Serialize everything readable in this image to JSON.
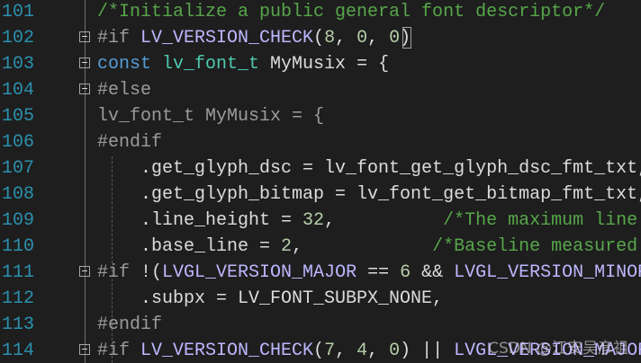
{
  "editor": {
    "lines": [
      {
        "num": "101",
        "tokens": [
          {
            "c": "cm",
            "t": "/*Initialize a public general font descriptor*/"
          }
        ]
      },
      {
        "num": "102",
        "tokens": [
          {
            "c": "pp",
            "t": "#if "
          },
          {
            "c": "mc",
            "t": "LV_VERSION_CHECK"
          },
          {
            "c": "id",
            "t": "("
          },
          {
            "c": "num",
            "t": "8"
          },
          {
            "c": "id",
            "t": ", "
          },
          {
            "c": "num",
            "t": "0"
          },
          {
            "c": "id",
            "t": ", "
          },
          {
            "c": "num",
            "t": "0"
          },
          {
            "c": "id",
            "t": ")"
          }
        ]
      },
      {
        "num": "103",
        "tokens": [
          {
            "c": "kw",
            "t": "const "
          },
          {
            "c": "ty",
            "t": "lv_font_t"
          },
          {
            "c": "id",
            "t": " MyMusix = {"
          }
        ]
      },
      {
        "num": "104",
        "tokens": [
          {
            "c": "pp",
            "t": "#else"
          }
        ]
      },
      {
        "num": "105",
        "tokens": [
          {
            "c": "dim",
            "t": "lv_font_t MyMusix = {"
          }
        ]
      },
      {
        "num": "106",
        "tokens": [
          {
            "c": "pp",
            "t": "#endif"
          }
        ]
      },
      {
        "num": "107",
        "tokens": [
          {
            "c": "id",
            "t": "    .get_glyph_dsc = lv_font_get_glyph_dsc_fmt_txt,"
          }
        ]
      },
      {
        "num": "108",
        "tokens": [
          {
            "c": "id",
            "t": "    .get_glyph_bitmap = lv_font_get_bitmap_fmt_txt,"
          }
        ]
      },
      {
        "num": "109",
        "tokens": [
          {
            "c": "id",
            "t": "    .line_height = "
          },
          {
            "c": "num",
            "t": "32"
          },
          {
            "c": "id",
            "t": ",          "
          },
          {
            "c": "cm",
            "t": "/*The maximum line"
          }
        ]
      },
      {
        "num": "110",
        "tokens": [
          {
            "c": "id",
            "t": "    .base_line = "
          },
          {
            "c": "num",
            "t": "2"
          },
          {
            "c": "id",
            "t": ",            "
          },
          {
            "c": "cm",
            "t": "/*Baseline measured"
          }
        ]
      },
      {
        "num": "111",
        "tokens": [
          {
            "c": "pp",
            "t": "#if "
          },
          {
            "c": "id",
            "t": "!("
          },
          {
            "c": "mc",
            "t": "LVGL_VERSION_MAJOR"
          },
          {
            "c": "id",
            "t": " == "
          },
          {
            "c": "num",
            "t": "6"
          },
          {
            "c": "id",
            "t": " && "
          },
          {
            "c": "mc",
            "t": "LVGL_VERSION_MINOR"
          }
        ]
      },
      {
        "num": "112",
        "tokens": [
          {
            "c": "id",
            "t": "    .subpx = LV_FONT_SUBPX_NONE,"
          }
        ]
      },
      {
        "num": "113",
        "tokens": [
          {
            "c": "pp",
            "t": "#endif"
          }
        ]
      },
      {
        "num": "114",
        "tokens": [
          {
            "c": "pp",
            "t": "#if "
          },
          {
            "c": "mc",
            "t": "LV_VERSION_CHECK"
          },
          {
            "c": "id",
            "t": "("
          },
          {
            "c": "num",
            "t": "7"
          },
          {
            "c": "id",
            "t": ", "
          },
          {
            "c": "num",
            "t": "4"
          },
          {
            "c": "id",
            "t": ", "
          },
          {
            "c": "num",
            "t": "0"
          },
          {
            "c": "id",
            "t": ") || "
          },
          {
            "c": "mc",
            "t": "LVGL_VERSION_MAJOR"
          }
        ]
      }
    ],
    "fold_markers": [
      "102",
      "103",
      "104",
      "111",
      "114"
    ]
  },
  "watermark": "CSDN @江安吴彦祖",
  "colors": {
    "background": "#1e1e1e",
    "line_number": "#2b91af",
    "comment": "#57a64a",
    "keyword": "#569cd6",
    "macro": "#beb7ff",
    "type": "#4ec9b0",
    "number": "#b5cea8"
  }
}
